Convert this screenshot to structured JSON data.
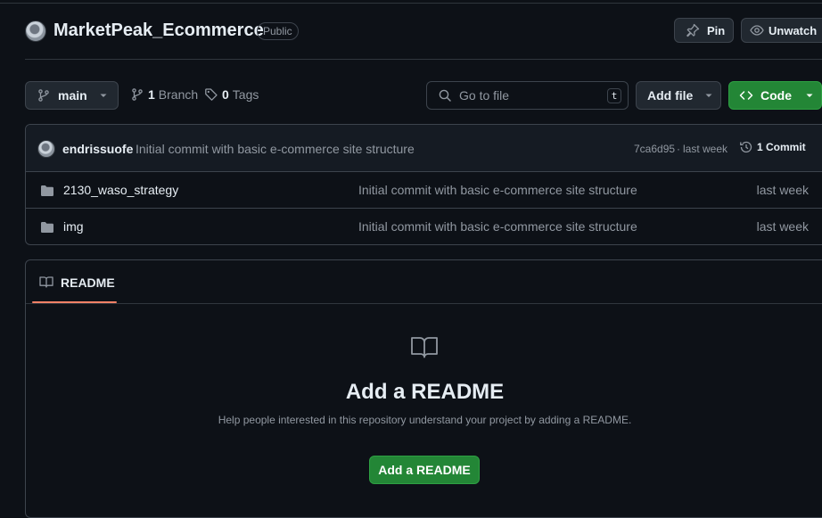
{
  "repo": {
    "name": "MarketPeak_Ecommerce",
    "visibility": "Public",
    "pin_label": "Pin",
    "unwatch_label": "Unwatch"
  },
  "toolbar": {
    "branch_name": "main",
    "branch_count": "1",
    "branch_label": "Branch",
    "tags_count": "0",
    "tags_label": "Tags",
    "search_placeholder": "Go to file",
    "search_shortcut": "t",
    "add_file_label": "Add file",
    "code_label": "Code"
  },
  "latest_commit": {
    "author": "endrissuofe",
    "message": "Initial commit with basic e-commerce site structure",
    "hash": "7ca6d95",
    "separator": "·",
    "time": "last week",
    "commit_count_label": "1 Commit"
  },
  "files": [
    {
      "name": "2130_waso_strategy",
      "message": "Initial commit with basic e-commerce site structure",
      "date": "last week"
    },
    {
      "name": "img",
      "message": "Initial commit with basic e-commerce site structure",
      "date": "last week"
    }
  ],
  "readme": {
    "tab_label": "README",
    "heading": "Add a README",
    "description": "Help people interested in this repository understand your project by adding a README.",
    "button_label": "Add a README"
  },
  "colors": {
    "background": "#0d1117",
    "border": "#3d444d",
    "accent_green": "#238636",
    "tab_underline": "#f78166"
  }
}
